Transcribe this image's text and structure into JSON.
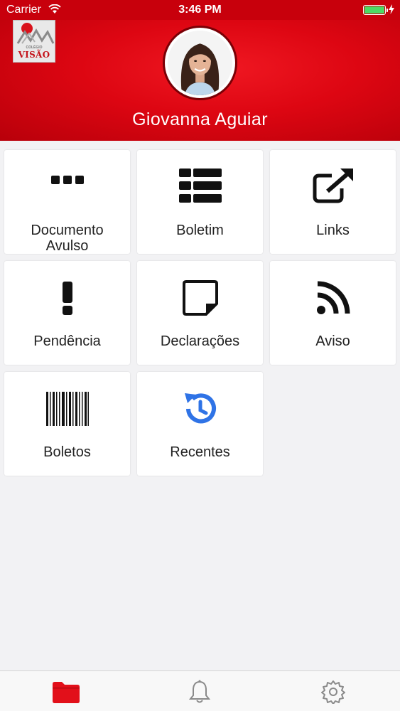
{
  "status_bar": {
    "carrier": "Carrier",
    "time": "3:46 PM"
  },
  "header": {
    "logo": {
      "text": "VISÃO",
      "subtext": "COLÉGIO"
    },
    "user_name": "Giovanna Aguiar"
  },
  "menu": [
    {
      "label": "Documento Avulso",
      "icon": "ellipsis-icon"
    },
    {
      "label": "Boletim",
      "icon": "list-table-icon"
    },
    {
      "label": "Links",
      "icon": "external-link-icon"
    },
    {
      "label": "Pendência",
      "icon": "exclamation-icon"
    },
    {
      "label": "Declarações",
      "icon": "sticky-note-icon"
    },
    {
      "label": "Aviso",
      "icon": "rss-icon"
    },
    {
      "label": "Boletos",
      "icon": "barcode-icon"
    },
    {
      "label": "Recentes",
      "icon": "history-icon"
    }
  ],
  "tabbar": {
    "items": [
      {
        "icon": "folder-icon",
        "active": true
      },
      {
        "icon": "bell-icon",
        "active": false
      },
      {
        "icon": "gear-icon",
        "active": false
      }
    ]
  },
  "colors": {
    "header_red": "#dd0612",
    "tile_bg": "#ffffff",
    "background": "#f2f2f4",
    "recent_icon_blue": "#2f73e6",
    "active_tab_red": "#e2101a"
  }
}
